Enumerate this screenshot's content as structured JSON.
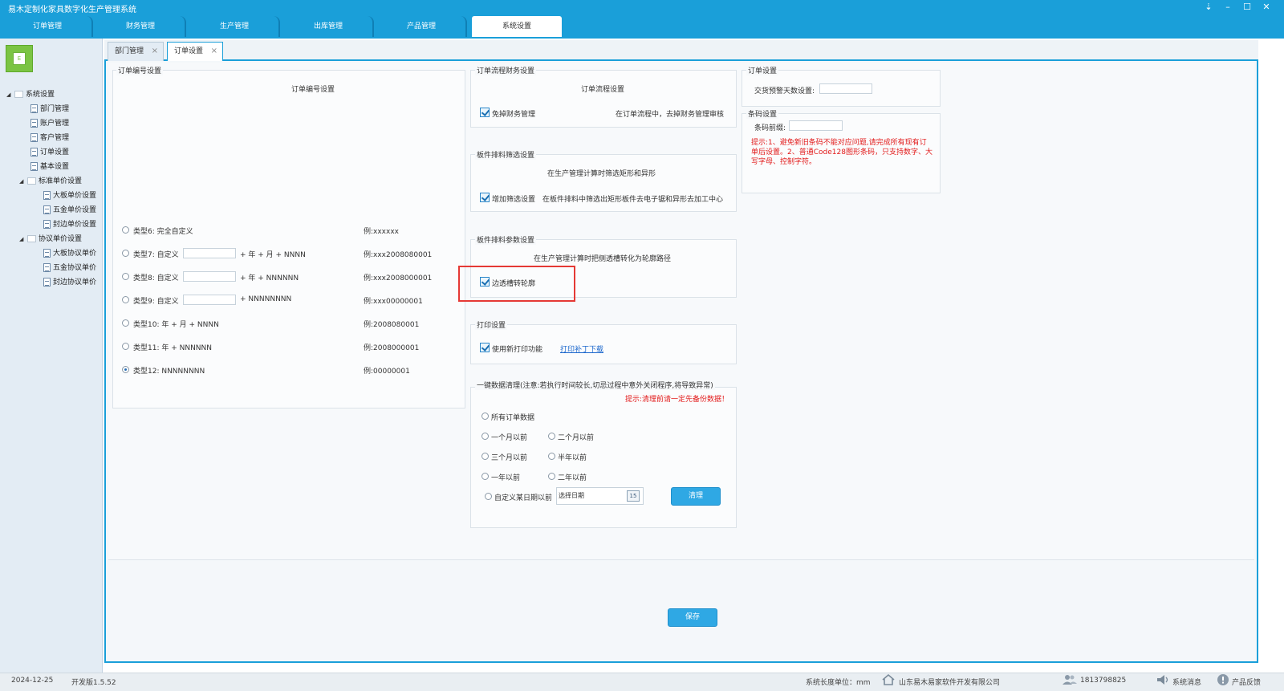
{
  "app": {
    "title": "易木定制化家具数字化生产管理系统",
    "window_controls": [
      "⇣",
      "–",
      "☐",
      "✕"
    ]
  },
  "main_tabs": [
    {
      "label": "订单管理",
      "active": false
    },
    {
      "label": "财务管理",
      "active": false
    },
    {
      "label": "生产管理",
      "active": false
    },
    {
      "label": "出库管理",
      "active": false
    },
    {
      "label": "产品管理",
      "active": false
    },
    {
      "label": "系统设置",
      "active": true
    }
  ],
  "logo_text": "E",
  "sidebar": {
    "tree": [
      {
        "label": "系统设置",
        "level": 0,
        "type": "folder"
      },
      {
        "label": "部门管理",
        "level": 1,
        "type": "doc"
      },
      {
        "label": "账户管理",
        "level": 1,
        "type": "doc"
      },
      {
        "label": "客户管理",
        "level": 1,
        "type": "doc"
      },
      {
        "label": "订单设置",
        "level": 1,
        "type": "doc"
      },
      {
        "label": "基本设置",
        "level": 1,
        "type": "doc"
      },
      {
        "label": "标准单价设置",
        "level": 1,
        "type": "folder"
      },
      {
        "label": "大板单价设置",
        "level": 2,
        "type": "doc"
      },
      {
        "label": "五金单价设置",
        "level": 2,
        "type": "doc"
      },
      {
        "label": "封边单价设置",
        "level": 2,
        "type": "doc"
      },
      {
        "label": "协议单价设置",
        "level": 1,
        "type": "folder"
      },
      {
        "label": "大板协议单价",
        "level": 2,
        "type": "doc"
      },
      {
        "label": "五金协议单价",
        "level": 2,
        "type": "doc"
      },
      {
        "label": "封边协议单价",
        "level": 2,
        "type": "doc"
      }
    ]
  },
  "sub_tabs": [
    {
      "label": "部门管理",
      "active": false
    },
    {
      "label": "订单设置",
      "active": true
    }
  ],
  "order_number": {
    "legend": "订单编号设置",
    "title": "订单编号设置",
    "types": [
      {
        "label": "类型6: 完全自定义",
        "suffix": "",
        "example": "例:xxxxxx",
        "selected": false,
        "has_input": false
      },
      {
        "label": "类型7: 自定义",
        "suffix": "+ 年 + 月 + NNNN",
        "example": "例:xxx2008080001",
        "selected": false,
        "has_input": true
      },
      {
        "label": "类型8: 自定义",
        "suffix": "+ 年 + NNNNNN",
        "example": "例:xxx2008000001",
        "selected": false,
        "has_input": true
      },
      {
        "label": "类型9: 自定义",
        "suffix": "+ NNNNNNNN",
        "example": "例:xxx00000001",
        "selected": false,
        "has_input": true
      },
      {
        "label": "类型10: 年 + 月 + NNNN",
        "suffix": "",
        "example": "例:2008080001",
        "selected": false,
        "has_input": false
      },
      {
        "label": "类型11: 年 + NNNNNN",
        "suffix": "",
        "example": "例:2008000001",
        "selected": false,
        "has_input": false
      },
      {
        "label": "类型12: NNNNNNNN",
        "suffix": "",
        "example": "例:00000001",
        "selected": true,
        "has_input": false
      }
    ]
  },
  "order_flow": {
    "legend": "订单流程财务设置",
    "title": "订单流程设置",
    "checkbox_label": "免掉财务管理",
    "checked": true,
    "description": "在订单流程中，去掉财务管理审核"
  },
  "nesting_filter": {
    "legend": "板件排料筛选设置",
    "title": "在生产管理计算时筛选矩形和异形",
    "checkbox_label": "增加筛选设置",
    "checked": true,
    "description": "在板件排料中筛选出矩形板件去电子锯和异形去加工中心"
  },
  "nesting_params": {
    "legend": "板件排料参数设置",
    "title": "在生产管理计算时把侧透槽转化为轮廓路径",
    "checkbox_label": "边透槽转轮廓",
    "checked": true
  },
  "print": {
    "legend": "打印设置",
    "checkbox_label": "使用新打印功能",
    "checked": true,
    "link": "打印补丁下载"
  },
  "cleanup": {
    "legend": "一键数据清理(注意:若执行时间较长,切忌过程中意外关闭程序,将导致异常)",
    "warning": "提示:清理前请一定先备份数据！",
    "options": {
      "all": "所有订单数据",
      "m1": "一个月以前",
      "m2": "二个月以前",
      "m3": "三个月以前",
      "half": "半年以前",
      "y1": "一年以前",
      "y2": "二年以前",
      "custom": "自定义某日期以前"
    },
    "date_placeholder": "选择日期",
    "calendar_day": "15",
    "button": "清理"
  },
  "order_settings": {
    "legend": "订单设置",
    "warn_days_label": "交货预警天数设置:",
    "warn_days_value": ""
  },
  "barcode": {
    "legend": "条码设置",
    "prefix_label": "条码前缀:",
    "prefix_value": "",
    "hint": "提示:1、避免新旧条码不能对应问题,请完成所有现有订单后设置。2、普通Code128图形条码，只支持数字、大写字母、控制字符。"
  },
  "save_button": "保存",
  "status": {
    "date": "2024-12-25",
    "version": "开发版1.5.52",
    "unit": "系统长度单位：mm",
    "company": "山东易木易家软件开发有限公司",
    "phone": "1813798825",
    "messages": "系统消息",
    "feedback": "产品反馈"
  },
  "colors": {
    "accent": "#1a9fd9",
    "warning_red": "#e21a1a",
    "highlight_box": "#e53935",
    "button": "#2fa8e4"
  }
}
